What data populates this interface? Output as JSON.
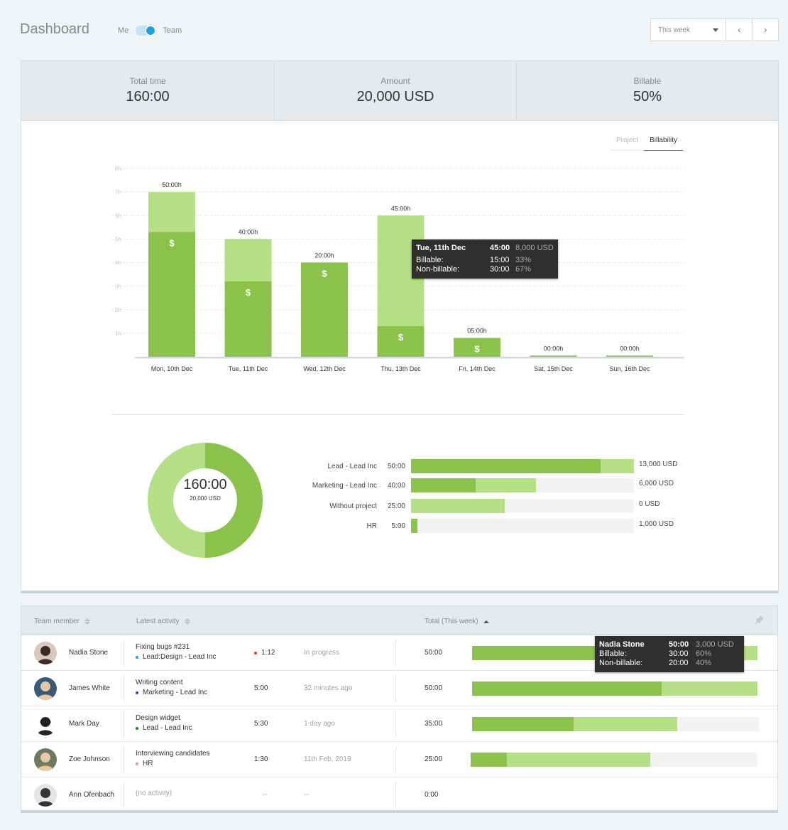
{
  "header": {
    "title": "Dashboard",
    "toggle_left": "Me",
    "toggle_right": "Team",
    "range_label": "This week",
    "prev_icon": "‹",
    "next_icon": "›"
  },
  "summary": {
    "total_time_label": "Total time",
    "total_time_value": "160:00",
    "amount_label": "Amount",
    "amount_value": "20,000 USD",
    "billable_label": "Billable",
    "billable_value": "50%"
  },
  "chart_tabs": [
    "Project",
    "Billability"
  ],
  "chart_data": {
    "type": "bar",
    "stacked": true,
    "categories": [
      "Mon, 10th Dec",
      "Tue, 11th Dec",
      "Wed, 12th Dec",
      "Thu, 13th Dec",
      "Fri, 14th Dec",
      "Sat, 15th Dec",
      "Sun, 16th Dec"
    ],
    "yticks": [
      "1h",
      "2h",
      "3h",
      "4h",
      "5h",
      "6h",
      "7h",
      "8h"
    ],
    "ylim": [
      0,
      8
    ],
    "grid": true,
    "series": [
      {
        "values": [
          5.3,
          3.2,
          4.0,
          1.3,
          0.8,
          0.05,
          0.05
        ],
        "color": "#8bc34a"
      },
      {
        "values": [
          1.7,
          1.8,
          0.0,
          4.7,
          0.0,
          0.0,
          0.0
        ],
        "color": "#b5df84"
      }
    ],
    "total_labels": [
      "50:00h",
      "40:00h",
      "20:00h",
      "45:00h",
      "05:00h",
      "00:00h",
      "00:00h"
    ],
    "billable_marker": "$",
    "tooltip": {
      "date": "Tue, 11th Dec",
      "total": "45:00",
      "amount": "8,000 USD",
      "billable_label": "Billable:",
      "billable_time": "15:00",
      "billable_pct": "33%",
      "nonbillable_label": "Non-billable:",
      "nonbillable_time": "30:00",
      "nonbillable_pct": "67%"
    }
  },
  "donut": {
    "total": "160:00",
    "amount": "20,000 USD",
    "billable_fraction": 0.5,
    "color_billable": "#8bc34a",
    "color_nonbillable": "#b5df84"
  },
  "projects": [
    {
      "name": "Lead - Lead Inc",
      "time": "50:00",
      "billable": 0.85,
      "nonbillable": 0.15,
      "amount": "13,000 USD"
    },
    {
      "name": "Marketing - Lead Inc",
      "time": "40:00",
      "billable": 0.29,
      "nonbillable": 0.27,
      "amount": "6,000 USD"
    },
    {
      "name": "Without project",
      "time": "25:00",
      "billable": 0.0,
      "nonbillable": 0.42,
      "amount": "0 USD"
    },
    {
      "name": "HR",
      "time": "5:00",
      "billable": 0.03,
      "nonbillable": 0.0,
      "amount": "1,000 USD"
    }
  ],
  "team": {
    "columns": {
      "member": "Team member",
      "activity": "Latest activity",
      "total": "Total (This week)"
    },
    "rows": [
      {
        "name": "Nadia Stone",
        "activity": "Fixing bugs #231",
        "project": "Lead:Design - Lead Inc",
        "dot": "#1ea1e6",
        "duration": "1:12",
        "running": true,
        "when": "In progress",
        "total": "50:00",
        "billable": 0.43,
        "nonbillable": 0.57,
        "bar_x": 635,
        "bar_w": 402,
        "avatar_bg": "#d9c8bd",
        "avatar_fg": "#3b2b24"
      },
      {
        "name": "James White",
        "activity": "Writing content",
        "project": "Marketing - Lead Inc",
        "dot": "#3949ab",
        "duration": "5:00",
        "running": false,
        "when": "32 minutes ago",
        "total": "50:00",
        "billable": 0.665,
        "nonbillable": 0.335,
        "bar_x": 635,
        "bar_w": 402,
        "avatar_bg": "#3b5b77",
        "avatar_fg": "#e7c7a8"
      },
      {
        "name": "Mark Day",
        "activity": "Design widget",
        "project": "Lead - Lead Inc",
        "dot": "#2e7d32",
        "duration": "5:30",
        "running": false,
        "when": "1 day ago",
        "total": "35:00",
        "billable": 0.355,
        "nonbillable": 0.36,
        "bar_x": 635,
        "bar_w": 404,
        "avatar_bg": "#ffffff",
        "avatar_fg": "#222222"
      },
      {
        "name": "Zoe Johnson",
        "activity": "Interviewing candidates",
        "project": "HR",
        "dot": "#f48fb1",
        "duration": "1:30",
        "running": false,
        "when": "11th Feb, 2019",
        "total": "25:00",
        "billable": 0.125,
        "nonbillable": 0.5,
        "bar_x": 633,
        "bar_w": 404,
        "avatar_bg": "#6d7b5c",
        "avatar_fg": "#e6c6a6"
      },
      {
        "name": "Ann Ofenbach",
        "activity": "(no activity)",
        "project": "",
        "dot": "",
        "duration": "--",
        "running": false,
        "when": "--",
        "total": "0:00",
        "billable": 0,
        "nonbillable": 0,
        "bar_x": 0,
        "bar_w": 0,
        "avatar_bg": "#e5e5e5",
        "avatar_fg": "#333333"
      }
    ],
    "tooltip": {
      "name": "Nadia Stone",
      "total": "50:00",
      "amount": "3,000 USD",
      "billable_label": "Billable:",
      "billable_time": "30:00",
      "billable_pct": "60%",
      "nonbillable_label": "Non-billable:",
      "nonbillable_time": "20:00",
      "nonbillable_pct": "40%"
    }
  }
}
